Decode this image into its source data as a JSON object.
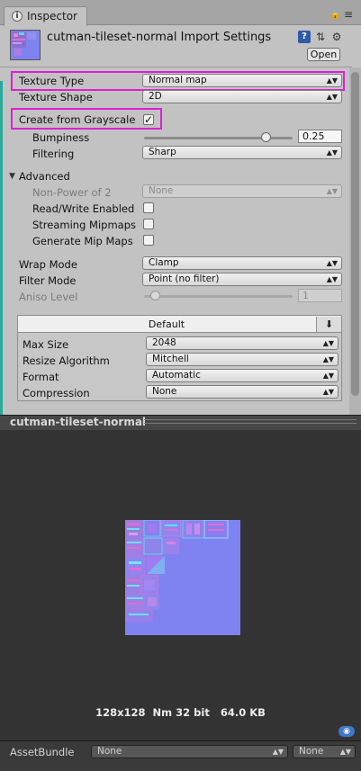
{
  "tab": {
    "label": "Inspector"
  },
  "header": {
    "title": "cutman-tileset-normal Import Settings",
    "open_label": "Open"
  },
  "settings": {
    "texture_type": {
      "label": "Texture Type",
      "value": "Normal map"
    },
    "texture_shape": {
      "label": "Texture Shape",
      "value": "2D"
    },
    "create_from_grayscale": {
      "label": "Create from Grayscale",
      "checked": true
    },
    "bumpiness": {
      "label": "Bumpiness",
      "value": "0.25",
      "fraction": 0.25
    },
    "filtering": {
      "label": "Filtering",
      "value": "Sharp"
    }
  },
  "advanced": {
    "label": "Advanced",
    "non_power_of_2": {
      "label": "Non-Power of 2",
      "value": "None"
    },
    "read_write": {
      "label": "Read/Write Enabled",
      "checked": false
    },
    "streaming_mipmaps": {
      "label": "Streaming Mipmaps",
      "checked": false
    },
    "generate_mip_maps": {
      "label": "Generate Mip Maps",
      "checked": false
    }
  },
  "wrap_mode": {
    "label": "Wrap Mode",
    "value": "Clamp"
  },
  "filter_mode": {
    "label": "Filter Mode",
    "value": "Point (no filter)"
  },
  "aniso_level": {
    "label": "Aniso Level",
    "value": "1"
  },
  "platform": {
    "tab_label": "Default",
    "max_size": {
      "label": "Max Size",
      "value": "2048"
    },
    "resize_algorithm": {
      "label": "Resize Algorithm",
      "value": "Mitchell"
    },
    "format": {
      "label": "Format",
      "value": "Automatic"
    },
    "compression": {
      "label": "Compression",
      "value": "None"
    }
  },
  "preview": {
    "title": "cutman-tileset-normal",
    "info": "128x128  Nm 32 bit   64.0 KB"
  },
  "asset_bundle": {
    "label": "AssetBundle",
    "name": "None",
    "variant": "None"
  },
  "colors": {
    "highlight": "#e01ed6",
    "normal_map": "#7f83f2",
    "preview_bg": "#333333"
  }
}
